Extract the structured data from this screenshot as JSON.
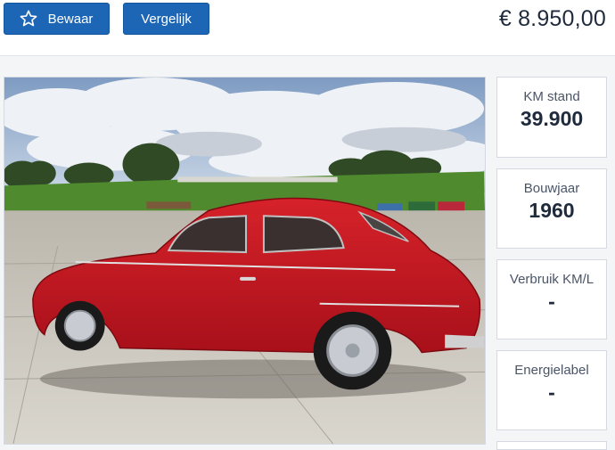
{
  "toolbar": {
    "save_label": "Bewaar",
    "compare_label": "Vergelijk",
    "price": "€ 8.950,00"
  },
  "photo": {
    "subject": "red-classic-car"
  },
  "stats": [
    {
      "label": "KM stand",
      "value": "39.900"
    },
    {
      "label": "Bouwjaar",
      "value": "1960"
    },
    {
      "label": "Verbruik KM/L",
      "value": "-"
    },
    {
      "label": "Energielabel",
      "value": "-"
    }
  ],
  "colors": {
    "button": "#1c66b5",
    "text": "#1f2a3c",
    "background": "#f4f5f7"
  }
}
